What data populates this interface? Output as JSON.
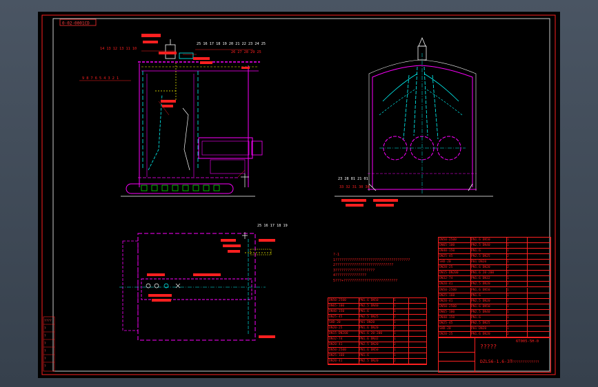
{
  "drawing": {
    "tag_label": "0-02-0001CD",
    "title_block_title": "?????",
    "drawing_number": "6T005-5H-0",
    "model_code": "DZL56-1.6-3T",
    "scale_note": "???????????????",
    "callouts_top": "25 16 17 18 19 20 21 22 23 24 25",
    "callouts_top2": "26 27 28 29 25",
    "callouts_left": "14 13 12 13 11 10",
    "callouts_left2": "9 8 7 6 5 4 3 2 1",
    "callouts_plan": "25 16 17 18 19",
    "callouts_section": "23 28 81 21 01",
    "callouts_section2": "33 32 31 30 30"
  },
  "notes": {
    "heading": "?-1",
    "lines": [
      "1????????????????????????????????????",
      "2????????????????????????????",
      "3???????????????????",
      "4???????????????",
      "5???+??????????????????????????"
    ]
  },
  "parts_table": {
    "rows": [
      [
        "DN50-2500",
        "PN1.6 DN50",
        "1",
        ""
      ],
      [
        "DN65-100",
        "PN2.5 DN40",
        "1",
        ""
      ],
      [
        "DN40-150",
        "PN1.6",
        "1",
        ""
      ],
      [
        "DN25-45",
        "PN2.5 DN25",
        "2",
        ""
      ],
      [
        "SHD-20",
        "P01 DN20",
        "1",
        ""
      ],
      [
        "DN20-25",
        "PN1.6 DN20",
        "2",
        ""
      ],
      [
        "DN15-DN200",
        "PN1.6 20-200",
        "1",
        ""
      ],
      [
        "DN32-74",
        "PN1.6 DN32",
        "1",
        ""
      ],
      [
        "DN20-41",
        "PN2.5 DN20",
        "2",
        ""
      ],
      [
        "DN50-2500",
        "PN1.6 DN50",
        "1",
        ""
      ],
      [
        "DN25-160",
        "PN1.6",
        "1",
        ""
      ],
      [
        "DN20-41",
        "PN2.5 DN20",
        "2",
        ""
      ]
    ]
  },
  "revision_block": {
    "labels": [
      "????",
      "?",
      "?",
      "?",
      "?",
      "?",
      "?"
    ]
  }
}
